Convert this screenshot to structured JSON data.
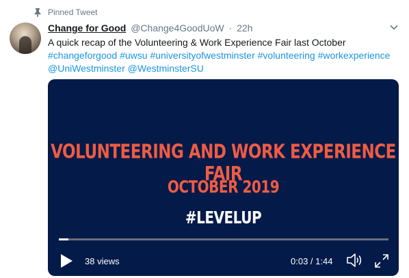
{
  "pinned": {
    "label": "Pinned Tweet",
    "icon": "pin-icon"
  },
  "author": {
    "name": "Change for Good",
    "handle": "@Change4GoodUoW",
    "separator": "·",
    "time": "22h"
  },
  "tweet": {
    "line1": "A quick recap of the Volunteering & Work Experience Fair last October",
    "hashtags": [
      "#changeforgood",
      "#uwsu",
      "#universityofwestminster",
      "#volunteering",
      "#workexperience"
    ],
    "mentions": [
      "@UniWestminster",
      "@WestminsterSU"
    ]
  },
  "video": {
    "title_line1": "VOLUNTEERING AND WORK EXPERIENCE FAIR",
    "title_line2": "OCTOBER 2019",
    "title_line3": "#LEVELUP",
    "views": "38 views",
    "time": "0:03 / 1:44",
    "progress": 0.03,
    "background_color": "#041a49",
    "title_color": "#ee5c44"
  },
  "colors": {
    "link": "#1b95e0",
    "muted": "#657786"
  }
}
